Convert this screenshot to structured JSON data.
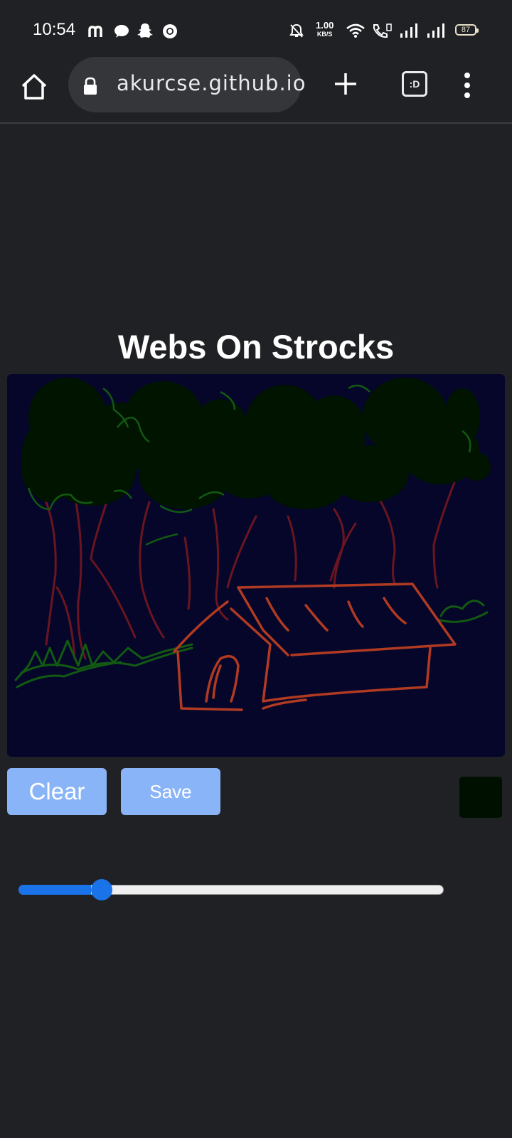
{
  "status_bar": {
    "time": "10:54",
    "net_speed_value": "1.00",
    "net_speed_unit": "KB/S",
    "battery": "87",
    "icons": [
      "m-app-icon",
      "message-icon",
      "snapchat-icon",
      "chrome-icon",
      "mute-icon",
      "wifi-icon",
      "call-icon",
      "signal-icon",
      "signal-icon-2"
    ]
  },
  "browser": {
    "url": "akurcse.github.io",
    "tab_switcher_label": ":D",
    "icons": [
      "home-icon",
      "lock-icon",
      "plus-icon",
      "tab-switcher-icon",
      "more-vert-icon"
    ]
  },
  "page": {
    "title": "Webs On Strocks",
    "clear_label": "Clear",
    "save_label": "Save",
    "selected_color": "#001000",
    "brush_size_fraction": 0.17
  },
  "colors": {
    "background": "#202124",
    "canvas_bg": "#05062a",
    "button_bg": "#8ab4f8",
    "slider_accent": "#1a73e8",
    "tree_canopy": "#001400",
    "trunk": "#6a1520",
    "grass": "#125a12",
    "house": "#b03a22"
  }
}
